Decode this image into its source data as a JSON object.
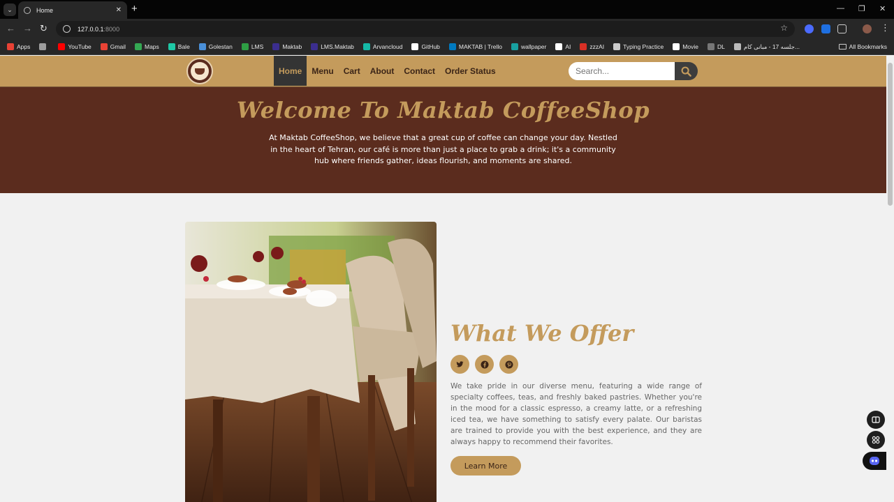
{
  "browser": {
    "tab_title": "Home",
    "url_host": "127.0.0.1",
    "url_port": ":8000",
    "bookmarks": [
      {
        "label": "Apps",
        "color": "#e94235"
      },
      {
        "label": "",
        "color": "#9e9e9e"
      },
      {
        "label": "YouTube",
        "color": "#ff0000"
      },
      {
        "label": "Gmail",
        "color": "#ea4335"
      },
      {
        "label": "Maps",
        "color": "#34a853"
      },
      {
        "label": "Bale",
        "color": "#1ec8a5"
      },
      {
        "label": "Golestan",
        "color": "#4a90d9"
      },
      {
        "label": "LMS",
        "color": "#2e9e44"
      },
      {
        "label": "Maktab",
        "color": "#3b2e8f"
      },
      {
        "label": "LMS.Maktab",
        "color": "#3b2e8f"
      },
      {
        "label": "Arvancloud",
        "color": "#15b8a6"
      },
      {
        "label": "GitHub",
        "color": "#ffffff"
      },
      {
        "label": "MAKTAB | Trello",
        "color": "#0079bf"
      },
      {
        "label": "wallpaper",
        "color": "#18a0a0"
      },
      {
        "label": "AI",
        "color": "#ffffff"
      },
      {
        "label": "zzzAI",
        "color": "#d93025"
      },
      {
        "label": "Typing Practice",
        "color": "#cccccc"
      },
      {
        "label": "Movie",
        "color": "#ffffff"
      },
      {
        "label": "DL",
        "color": "#777777"
      },
      {
        "label": "جلسه 17 - مبانی کام...",
        "color": "#bbbbbb"
      }
    ],
    "all_bookmarks": "All Bookmarks"
  },
  "site": {
    "nav": [
      "Home",
      "Menu",
      "Cart",
      "About",
      "Contact",
      "Order Status"
    ],
    "active_nav": "Home",
    "search_placeholder": "Search...",
    "colors": {
      "accent": "#c49b5c",
      "brown": "#5b2c1e",
      "dark": "#343434"
    }
  },
  "hero": {
    "title": "Welcome To Maktab CoffeeShop",
    "text": "At Maktab CoffeeShop, we believe that a great cup of coffee can change your day. Nestled in the heart of Tehran, our café is more than just a place to grab a drink; it's a community hub where friends gather, ideas flourish, and moments are shared."
  },
  "offer": {
    "title": "What We Offer",
    "socials": [
      "twitter-icon",
      "facebook-icon",
      "pinterest-icon"
    ],
    "text": "We take pride in our diverse menu, featuring a wide range of specialty coffees, teas, and freshly baked pastries. Whether you're in the mood for a classic espresso, a creamy latte, or a refreshing iced tea, we have something to satisfy every palate. Our baristas are trained to provide you with the best experience, and they are always happy to recommend their favorites.",
    "button": "Learn More"
  }
}
